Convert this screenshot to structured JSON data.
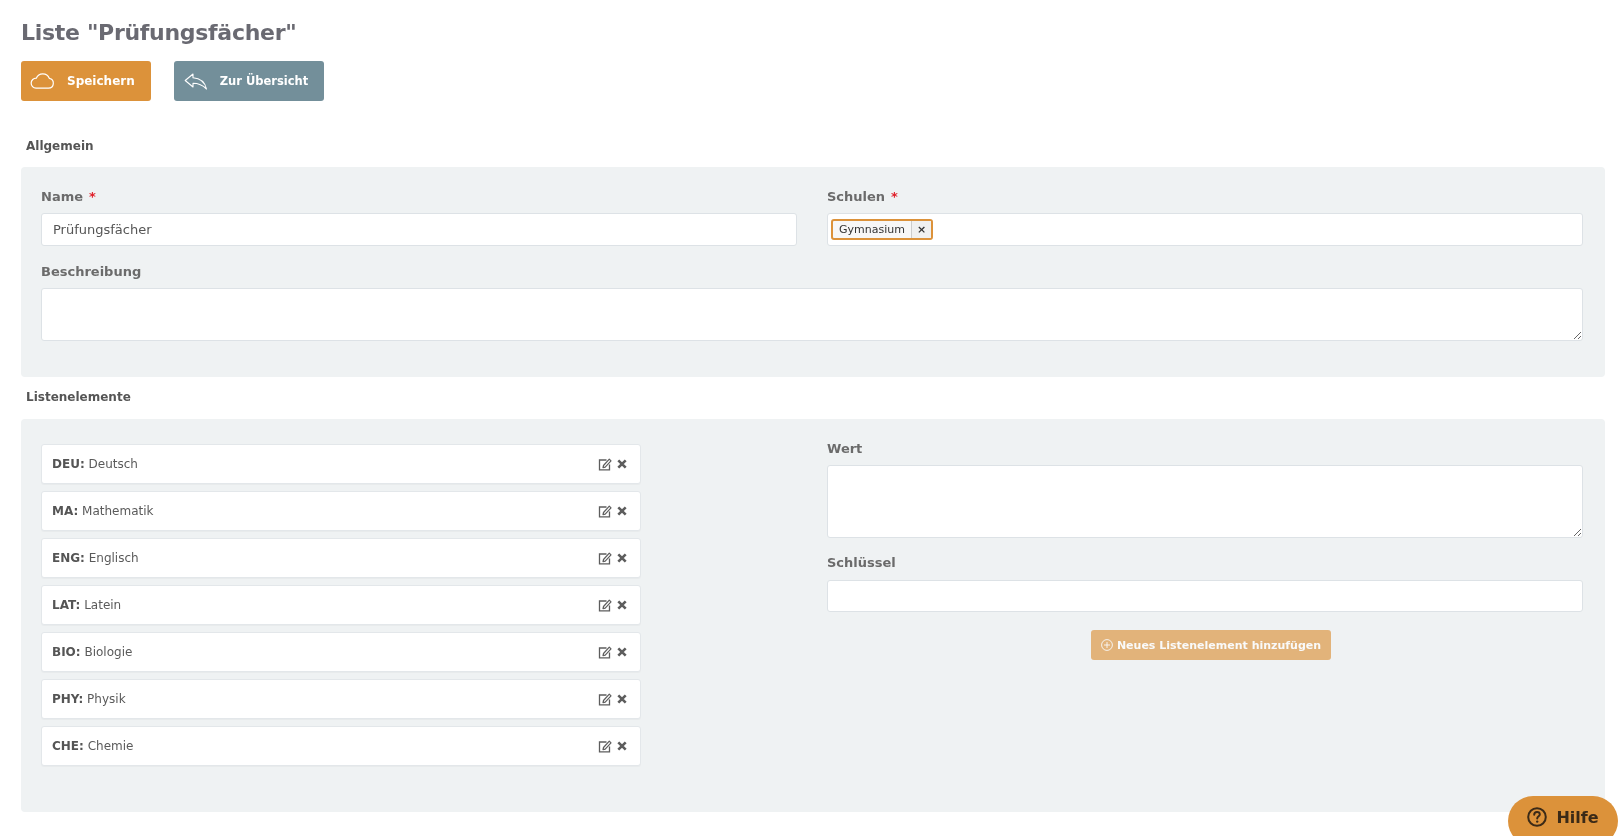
{
  "page": {
    "title": "Liste \"Prüfungsfächer\""
  },
  "toolbar": [
    {
      "kind": "save",
      "label": "Speichern"
    },
    {
      "kind": "back",
      "label": "Zur Übersicht"
    }
  ],
  "general": {
    "heading": "Allgemein",
    "name": {
      "label": "Name",
      "required_mark": "*",
      "value": "Prüfungsfächer"
    },
    "schools": {
      "label": "Schulen",
      "required_mark": "*",
      "tags": [
        {
          "label": "Gymnasium",
          "remove": "×"
        }
      ]
    },
    "description": {
      "label": "Beschreibung"
    }
  },
  "list_elements": {
    "heading": "Listenelemente",
    "items": [
      {
        "text": "**DEU:** Deutsch"
      },
      {
        "text": "**MA:** Mathematik"
      },
      {
        "text": "**ENG:** Englisch"
      },
      {
        "text": "**LAT:** Latein"
      },
      {
        "text": "**BIO:** Biologie"
      },
      {
        "text": "**PHY:** Physik"
      },
      {
        "text": "**CHE:** Chemie"
      }
    ],
    "value_field": {
      "label": "Wert"
    },
    "key_field": {
      "label": "Schlüssel"
    },
    "add_button": {
      "label": "Neues Listenelement hinzufügen",
      "disabled": true
    }
  },
  "help_button": {
    "label": "Hilfe"
  }
}
